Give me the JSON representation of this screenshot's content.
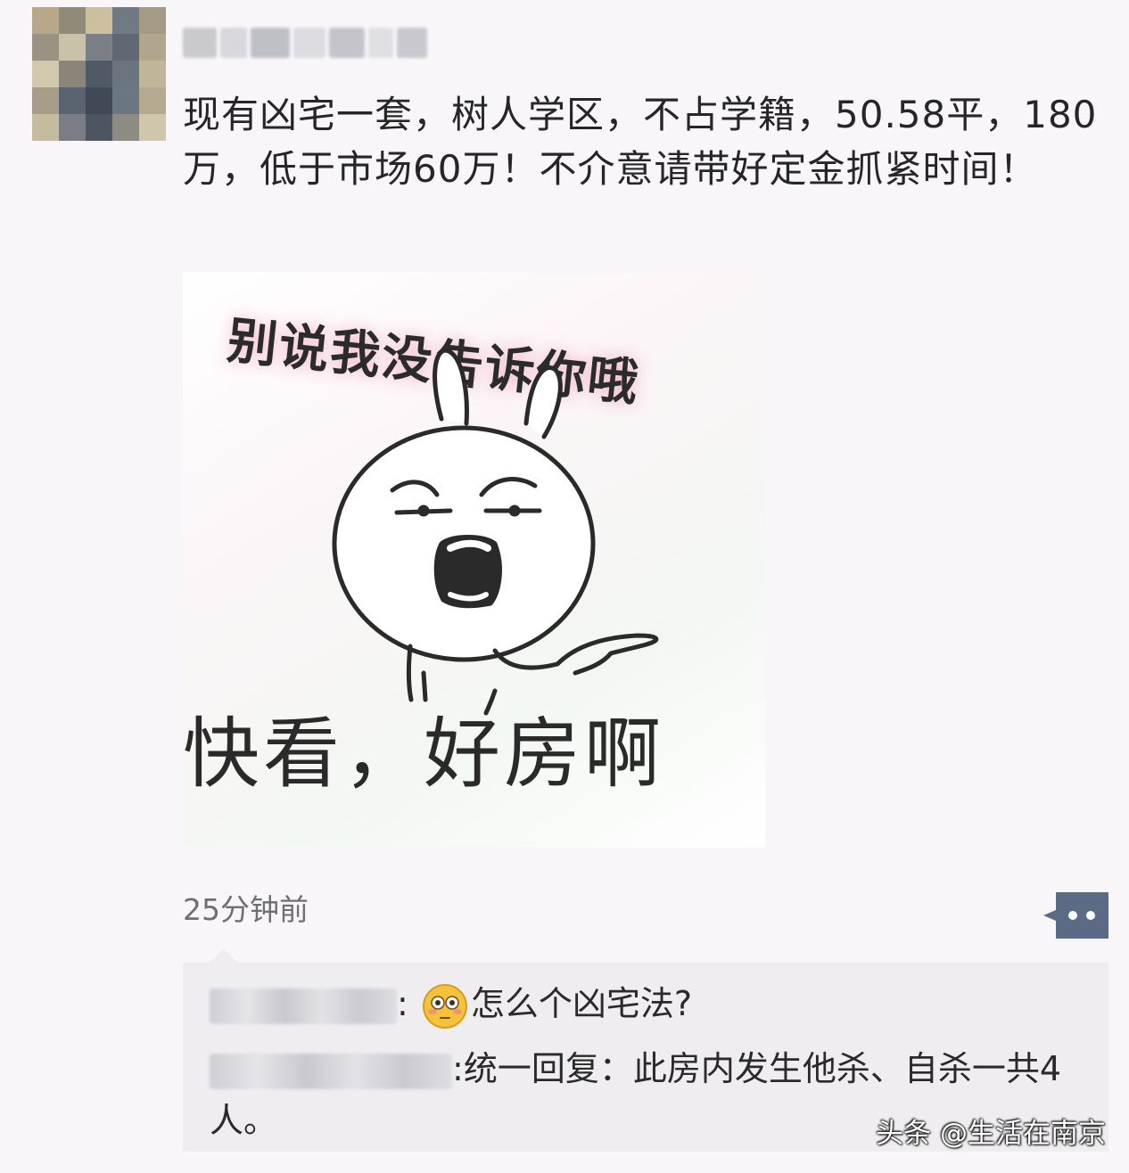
{
  "post": {
    "author": "████ ██ ███",
    "text": "现有凶宅一套，树人学区，不占学籍，50.58平，180万，低于市场60万！不介意请带好定金抓紧时间！",
    "image": {
      "top_caption": "别说我没告诉你哦",
      "bottom_caption": "快看，好房啊"
    },
    "timestamp": "25分钟前"
  },
  "comments": [
    {
      "author": "████ ███",
      "separator": ":",
      "emoji": "flushed-face-emoji",
      "text": "怎么个凶宅法?"
    },
    {
      "author": "████ ██",
      "separator": ":",
      "text": "统一回复：此房内发生他杀、自杀一共4人。"
    }
  ],
  "watermark": "头条 @生活在南京"
}
